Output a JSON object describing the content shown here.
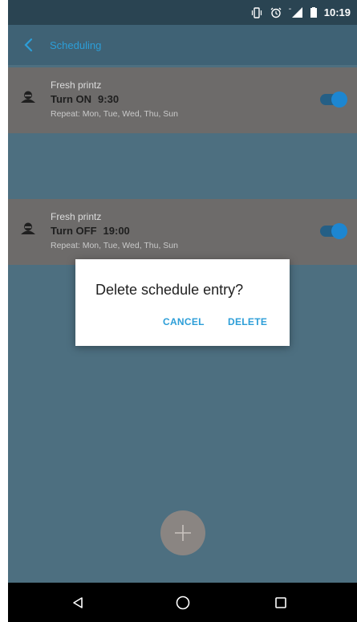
{
  "status_bar": {
    "time": "10:19"
  },
  "app_bar": {
    "title": "Scheduling"
  },
  "entries": [
    {
      "name": "Fresh printz",
      "action": "Turn ON",
      "time": "9:30",
      "repeat": "Repeat: Mon, Tue, Wed, Thu, Sun",
      "enabled": true
    },
    {
      "name": "Fresh printz",
      "action": "Turn OFF",
      "time": "19:00",
      "repeat": "Repeat: Mon, Tue, Wed, Thu, Sun",
      "enabled": true
    }
  ],
  "dialog": {
    "title": "Delete schedule entry?",
    "cancel_label": "CANCEL",
    "delete_label": "DELETE"
  },
  "fab": {
    "icon": "plus-icon"
  },
  "nav_bar": {
    "icons": [
      "back-triangle-icon",
      "home-circle-icon",
      "recents-square-icon"
    ]
  },
  "colors": {
    "accent": "#2c9ed8",
    "toggle_on": "#1d86d1",
    "app_bar": "#3f6275"
  }
}
